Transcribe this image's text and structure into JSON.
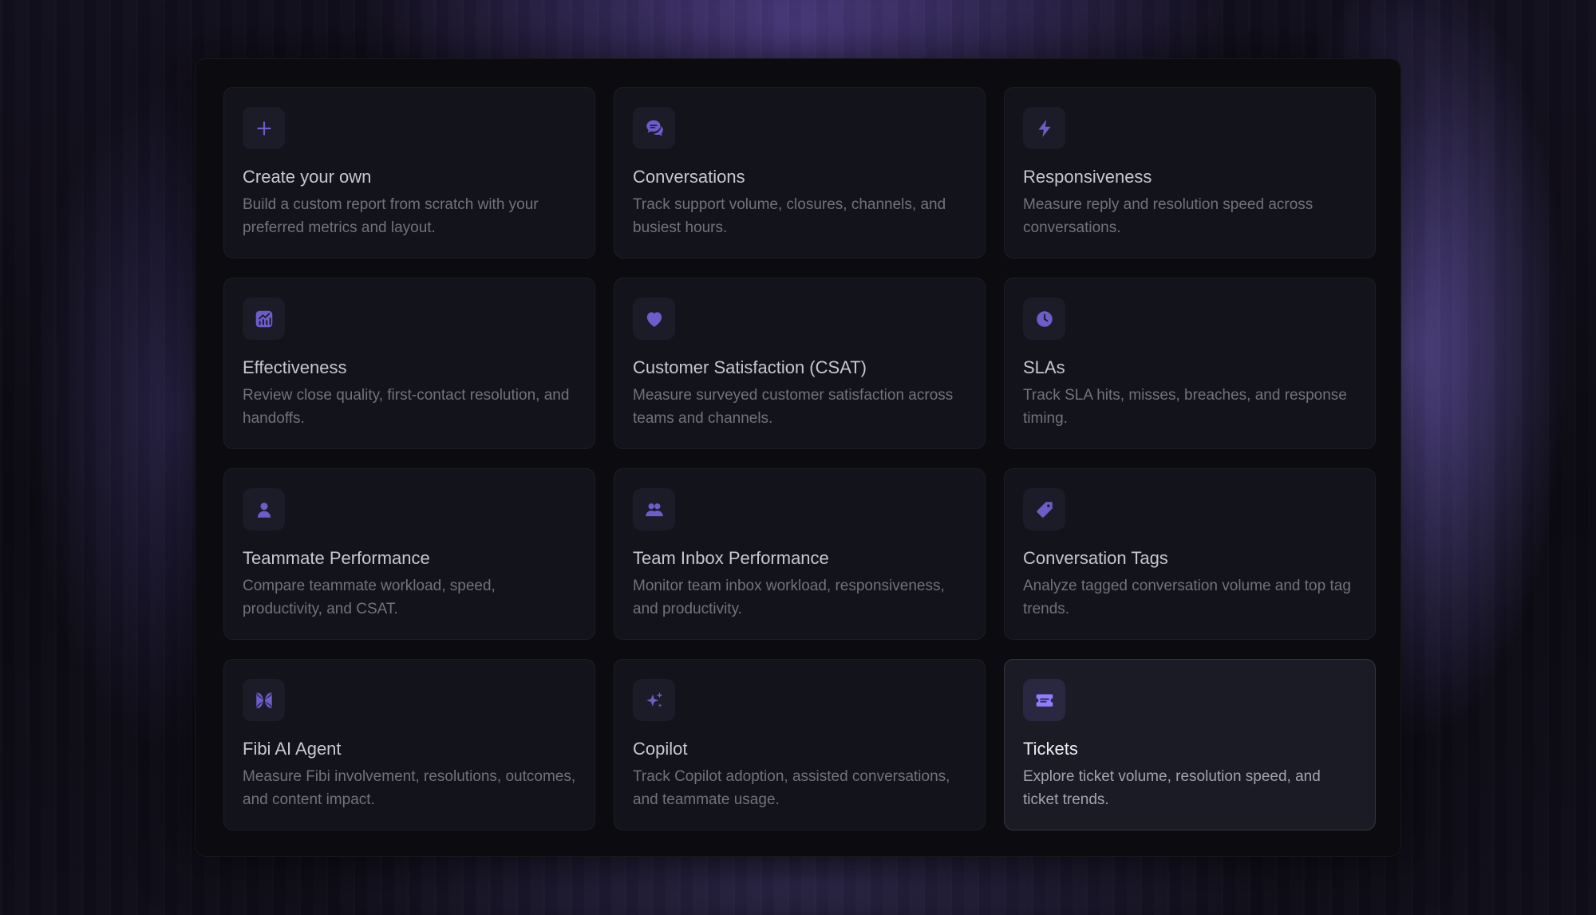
{
  "accent_color": "#6d5cc9",
  "reports": [
    {
      "title": "Create your own",
      "description": "Build a custom report from scratch with your preferred metrics and layout.",
      "icon": "plus-icon"
    },
    {
      "title": "Conversations",
      "description": "Track support volume, closures, channels, and busiest hours.",
      "icon": "chat-bubbles-icon"
    },
    {
      "title": "Responsiveness",
      "description": "Measure reply and resolution speed across conversations.",
      "icon": "lightning-bolt-icon"
    },
    {
      "title": "Effectiveness",
      "description": "Review close quality, first-contact resolution, and handoffs.",
      "icon": "chart-icon"
    },
    {
      "title": "Customer Satisfaction (CSAT)",
      "description": "Measure surveyed customer satisfaction across teams and channels.",
      "icon": "heart-icon"
    },
    {
      "title": "SLAs",
      "description": "Track SLA hits, misses, breaches, and response timing.",
      "icon": "clock-icon"
    },
    {
      "title": "Teammate Performance",
      "description": "Compare teammate workload, speed, productivity, and CSAT.",
      "icon": "person-icon"
    },
    {
      "title": "Team Inbox Performance",
      "description": "Monitor team inbox workload, responsiveness, and productivity.",
      "icon": "team-icon"
    },
    {
      "title": "Conversation Tags",
      "description": "Analyze tagged conversation volume and top tag trends.",
      "icon": "tag-icon"
    },
    {
      "title": "Fibi AI Agent",
      "description": "Measure Fibi involvement, resolutions, outcomes, and content impact.",
      "icon": "fibi-logo-icon"
    },
    {
      "title": "Copilot",
      "description": "Track Copilot adoption, assisted conversations, and teammate usage.",
      "icon": "sparkles-icon"
    },
    {
      "title": "Tickets",
      "description": "Explore ticket volume, resolution speed, and ticket trends.",
      "icon": "ticket-icon",
      "selected": true
    }
  ]
}
